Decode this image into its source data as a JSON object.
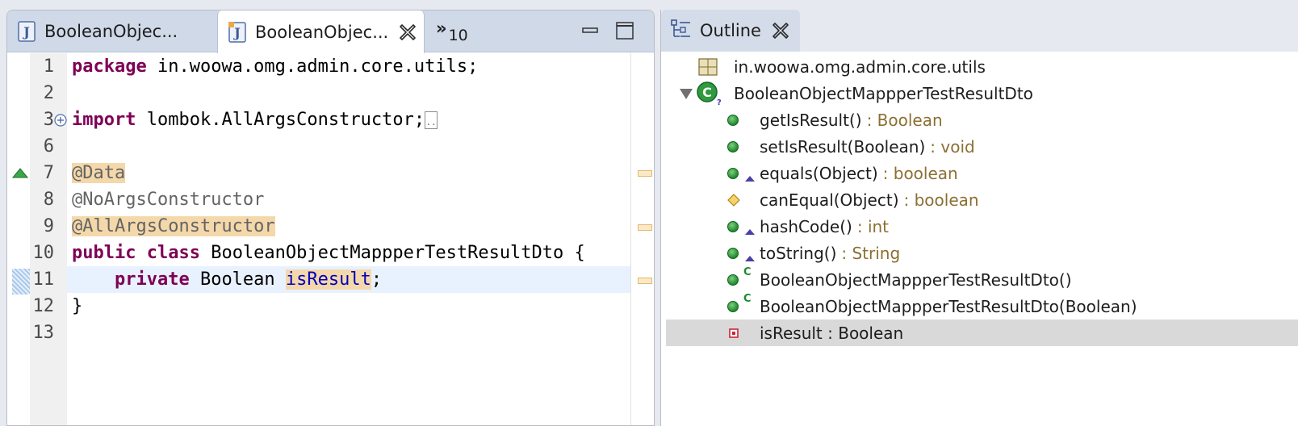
{
  "editor": {
    "tabs": [
      {
        "label": "BooleanObjec..."
      },
      {
        "label": "BooleanObjec..."
      }
    ],
    "more_tabs": {
      "symbol": "»",
      "count": "10"
    },
    "lines": [
      {
        "num": "1"
      },
      {
        "num": "2"
      },
      {
        "num": "3"
      },
      {
        "num": "6"
      },
      {
        "num": "7"
      },
      {
        "num": "8"
      },
      {
        "num": "9"
      },
      {
        "num": "10"
      },
      {
        "num": "11"
      },
      {
        "num": "12"
      },
      {
        "num": "13"
      }
    ],
    "code": {
      "l1_kw": "package",
      "l1_rest": " in.woowa.omg.admin.core.utils;",
      "l3_kw": "import",
      "l3_rest": " lombok.AllArgsConstructor;",
      "l7_ann": "@Data",
      "l8_ann": "@NoArgsConstructor",
      "l9_ann": "@AllArgsConstructor",
      "l10_kw": "public class",
      "l10_rest": " BooleanObjectMappperTestResultDto {",
      "l11_indent": "    ",
      "l11_kw": "private",
      "l11_type": " Boolean ",
      "l11_field": "isResult",
      "l11_end": ";",
      "l12": "}"
    }
  },
  "outline": {
    "tab_label": "Outline",
    "package": "in.woowa.omg.admin.core.utils",
    "class_name": "BooleanObjectMappperTestResultDto",
    "members": [
      {
        "name": "getIsResult()",
        "type": ": Boolean"
      },
      {
        "name": "setIsResult(Boolean)",
        "type": ": void"
      },
      {
        "name": "equals(Object)",
        "type": ": boolean"
      },
      {
        "name": "canEqual(Object)",
        "type": ": boolean"
      },
      {
        "name": "hashCode()",
        "type": ": int"
      },
      {
        "name": "toString()",
        "type": ": String"
      },
      {
        "name": "BooleanObjectMappperTestResultDto()",
        "type": ""
      },
      {
        "name": "BooleanObjectMappperTestResultDto(Boolean)",
        "type": ""
      },
      {
        "name": "isResult : Boolean",
        "type": ""
      }
    ]
  }
}
